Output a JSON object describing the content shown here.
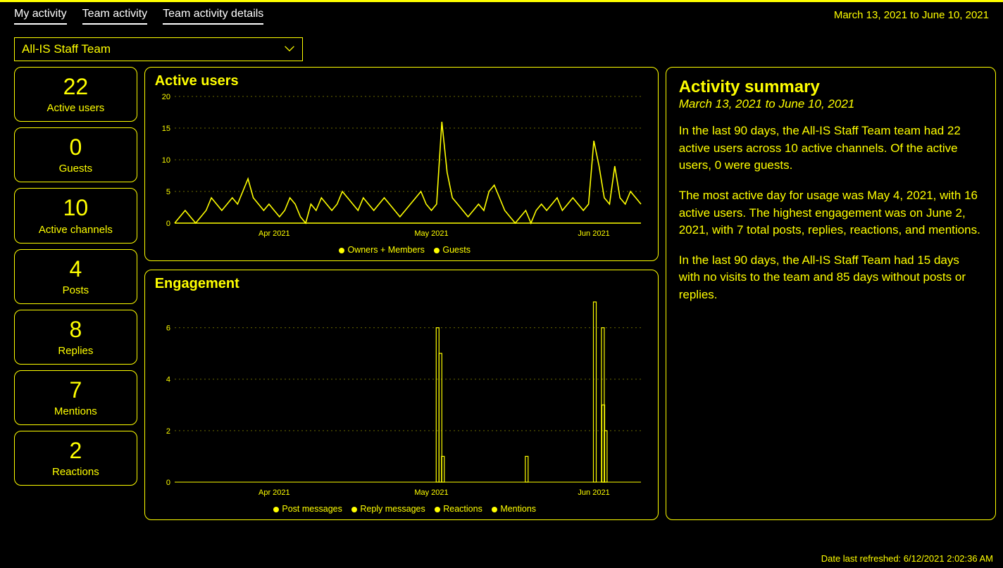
{
  "tabs": {
    "my_activity": "My activity",
    "team_activity": "Team activity",
    "team_activity_details": "Team activity details"
  },
  "date_range_top": "March 13, 2021 to June 10, 2021",
  "team_select": {
    "value": "All-IS Staff Team"
  },
  "stats": {
    "active_users": {
      "value": "22",
      "label": "Active users"
    },
    "guests": {
      "value": "0",
      "label": "Guests"
    },
    "active_channels": {
      "value": "10",
      "label": "Active channels"
    },
    "posts": {
      "value": "4",
      "label": "Posts"
    },
    "replies": {
      "value": "8",
      "label": "Replies"
    },
    "mentions": {
      "value": "7",
      "label": "Mentions"
    },
    "reactions": {
      "value": "2",
      "label": "Reactions"
    }
  },
  "charts": {
    "active_users": {
      "title": "Active users",
      "legend": {
        "a": "Owners + Members",
        "b": "Guests"
      }
    },
    "engagement": {
      "title": "Engagement",
      "legend": {
        "a": "Post messages",
        "b": "Reply messages",
        "c": "Reactions",
        "d": "Mentions"
      }
    },
    "x_ticks": {
      "apr": "Apr 2021",
      "may": "May 2021",
      "jun": "Jun 2021"
    }
  },
  "summary": {
    "title": "Activity summary",
    "range": "March 13, 2021 to June 10, 2021",
    "p1": "In the last 90 days, the All-IS Staff Team team had 22 active users across 10 active channels. Of the active users, 0 were guests.",
    "p2": "The most active day for usage was May 4, 2021, with 16 active users. The highest engagement was on June 2, 2021, with 7 total posts, replies, reactions, and mentions.",
    "p3": "In the last 90 days, the All-IS Staff Team had 15  days with no visits to the team and 85 days without posts or replies."
  },
  "footer": {
    "refreshed": "Date last refreshed: 6/12/2021 2:02:36 AM"
  },
  "chart_data": [
    {
      "type": "line",
      "title": "Active users",
      "xlabel": "",
      "ylabel": "",
      "ylim": [
        0,
        20
      ],
      "x_ticks": [
        "Apr 2021",
        "May 2021",
        "Jun 2021"
      ],
      "y_ticks": [
        0,
        5,
        10,
        15,
        20
      ],
      "series": [
        {
          "name": "Owners + Members",
          "x_start": "2021-03-13",
          "x_end": "2021-06-10",
          "values": [
            0,
            1,
            2,
            1,
            0,
            1,
            2,
            4,
            3,
            2,
            3,
            4,
            3,
            5,
            7,
            4,
            3,
            2,
            3,
            2,
            1,
            2,
            4,
            3,
            1,
            0,
            3,
            2,
            4,
            3,
            2,
            3,
            5,
            4,
            3,
            2,
            4,
            3,
            2,
            3,
            4,
            3,
            2,
            1,
            2,
            3,
            4,
            5,
            3,
            2,
            3,
            16,
            8,
            4,
            3,
            2,
            1,
            2,
            3,
            2,
            5,
            6,
            4,
            2,
            1,
            0,
            1,
            2,
            0,
            2,
            3,
            2,
            3,
            4,
            2,
            3,
            4,
            3,
            2,
            3,
            13,
            9,
            4,
            3,
            9,
            4,
            3,
            5,
            4,
            3
          ]
        },
        {
          "name": "Guests",
          "x_start": "2021-03-13",
          "x_end": "2021-06-10",
          "values": [
            0,
            0,
            0,
            0,
            0,
            0,
            0,
            0,
            0,
            0,
            0,
            0,
            0,
            0,
            0,
            0,
            0,
            0,
            0,
            0,
            0,
            0,
            0,
            0,
            0,
            0,
            0,
            0,
            0,
            0,
            0,
            0,
            0,
            0,
            0,
            0,
            0,
            0,
            0,
            0,
            0,
            0,
            0,
            0,
            0,
            0,
            0,
            0,
            0,
            0,
            0,
            0,
            0,
            0,
            0,
            0,
            0,
            0,
            0,
            0,
            0,
            0,
            0,
            0,
            0,
            0,
            0,
            0,
            0,
            0,
            0,
            0,
            0,
            0,
            0,
            0,
            0,
            0,
            0,
            0,
            0,
            0,
            0,
            0,
            0,
            0,
            0,
            0,
            0,
            0
          ]
        }
      ]
    },
    {
      "type": "bar",
      "title": "Engagement",
      "xlabel": "",
      "ylabel": "",
      "ylim": [
        0,
        7
      ],
      "x_ticks": [
        "Apr 2021",
        "May 2021",
        "Jun 2021"
      ],
      "y_ticks": [
        0,
        2,
        4,
        6
      ],
      "categories_note": "daily bins Mar 13 – Jun 10; nonzero days listed below",
      "series": [
        {
          "name": "Post messages",
          "points": [
            {
              "x": "2021-05-03",
              "y": 6
            },
            {
              "x": "2021-05-04",
              "y": 1
            },
            {
              "x": "2021-05-20",
              "y": 1
            },
            {
              "x": "2021-06-02",
              "y": 7
            }
          ]
        },
        {
          "name": "Reply messages",
          "points": [
            {
              "x": "2021-05-03",
              "y": 5
            },
            {
              "x": "2021-06-03",
              "y": 6
            }
          ]
        },
        {
          "name": "Reactions",
          "points": [
            {
              "x": "2021-06-03",
              "y": 2
            }
          ]
        },
        {
          "name": "Mentions",
          "points": [
            {
              "x": "2021-06-02",
              "y": 3
            }
          ]
        }
      ]
    }
  ]
}
